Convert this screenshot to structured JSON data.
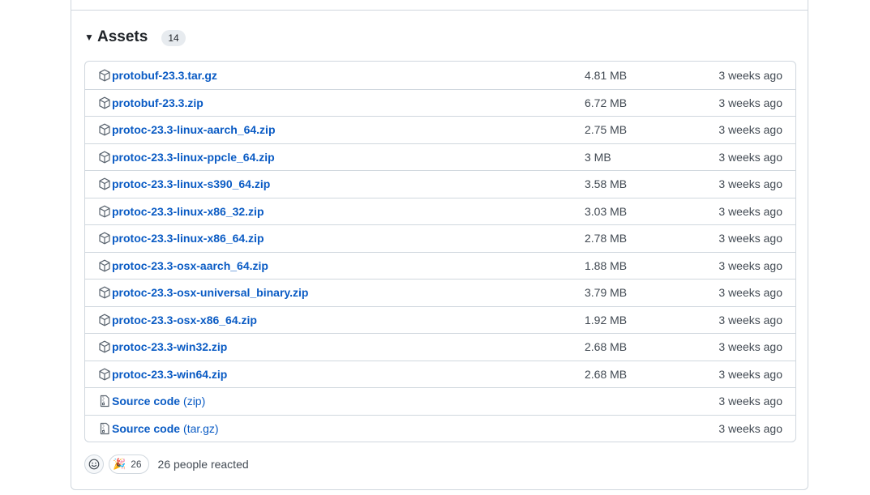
{
  "assets": {
    "title": "Assets",
    "count": "14",
    "items": [
      {
        "name": "protobuf-23.3.tar.gz",
        "suffix": "",
        "size": "4.81 MB",
        "date": "3 weeks ago",
        "icon": "package-icon"
      },
      {
        "name": "protobuf-23.3.zip",
        "suffix": "",
        "size": "6.72 MB",
        "date": "3 weeks ago",
        "icon": "package-icon"
      },
      {
        "name": "protoc-23.3-linux-aarch_64.zip",
        "suffix": "",
        "size": "2.75 MB",
        "date": "3 weeks ago",
        "icon": "package-icon"
      },
      {
        "name": "protoc-23.3-linux-ppcle_64.zip",
        "suffix": "",
        "size": "3 MB",
        "date": "3 weeks ago",
        "icon": "package-icon"
      },
      {
        "name": "protoc-23.3-linux-s390_64.zip",
        "suffix": "",
        "size": "3.58 MB",
        "date": "3 weeks ago",
        "icon": "package-icon"
      },
      {
        "name": "protoc-23.3-linux-x86_32.zip",
        "suffix": "",
        "size": "3.03 MB",
        "date": "3 weeks ago",
        "icon": "package-icon"
      },
      {
        "name": "protoc-23.3-linux-x86_64.zip",
        "suffix": "",
        "size": "2.78 MB",
        "date": "3 weeks ago",
        "icon": "package-icon"
      },
      {
        "name": "protoc-23.3-osx-aarch_64.zip",
        "suffix": "",
        "size": "1.88 MB",
        "date": "3 weeks ago",
        "icon": "package-icon"
      },
      {
        "name": "protoc-23.3-osx-universal_binary.zip",
        "suffix": "",
        "size": "3.79 MB",
        "date": "3 weeks ago",
        "icon": "package-icon"
      },
      {
        "name": "protoc-23.3-osx-x86_64.zip",
        "suffix": "",
        "size": "1.92 MB",
        "date": "3 weeks ago",
        "icon": "package-icon"
      },
      {
        "name": "protoc-23.3-win32.zip",
        "suffix": "",
        "size": "2.68 MB",
        "date": "3 weeks ago",
        "icon": "package-icon"
      },
      {
        "name": "protoc-23.3-win64.zip",
        "suffix": "",
        "size": "2.68 MB",
        "date": "3 weeks ago",
        "icon": "package-icon"
      },
      {
        "name": "Source code",
        "suffix": "(zip)",
        "size": "",
        "date": "3 weeks ago",
        "icon": "file-zip-icon"
      },
      {
        "name": "Source code",
        "suffix": "(tar.gz)",
        "size": "",
        "date": "3 weeks ago",
        "icon": "file-zip-icon"
      }
    ]
  },
  "reactions": {
    "add_icon": "smiley-icon",
    "emoji": "🎉",
    "count": "26",
    "summary": "26 people reacted"
  },
  "colors": {
    "link": "#0a5bc4",
    "border": "#d0d7de",
    "muted_text": "#424a53"
  }
}
